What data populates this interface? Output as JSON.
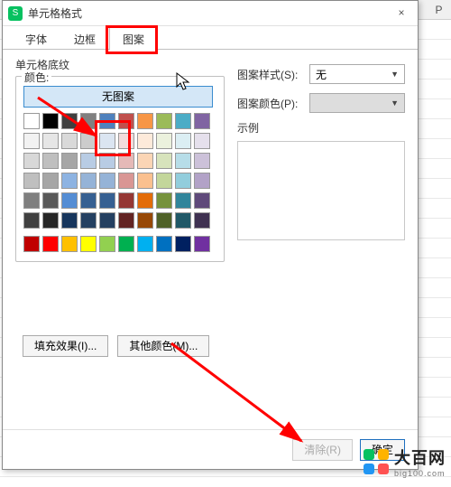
{
  "sheet": {
    "col_p": "P"
  },
  "dialog": {
    "title": "单元格格式",
    "close": "×",
    "tabs": {
      "font": "字体",
      "border": "边框",
      "pattern": "图案"
    },
    "section_title": "单元格底纹",
    "color_legend": "颜色:",
    "no_pattern": "无图案",
    "pattern_style_label": "图案样式(S):",
    "pattern_style_value": "无",
    "pattern_color_label": "图案颜色(P):",
    "preview_label": "示例",
    "fill_effects": "填充效果(I)...",
    "more_colors": "其他颜色(M)...",
    "clear": "清除(R)",
    "ok": "确定"
  },
  "palette": {
    "row1": [
      "#ffffff",
      "#000000",
      "#404040",
      "#808080",
      "#4f81bd",
      "#c0504d",
      "#f79646",
      "#9bbb59",
      "#4bacc6",
      "#8064a2"
    ],
    "row2": [
      "#f2f2f2",
      "#e6e6e6",
      "#d9d9d9",
      "#cccccc",
      "#dbe5f1",
      "#f2dcdb",
      "#fdeada",
      "#ebf1dd",
      "#dbeef3",
      "#e5e0ec"
    ],
    "row3": [
      "#d8d8d8",
      "#bfbfbf",
      "#a6a6a6",
      "#b8cce4",
      "#b8cce4",
      "#e5b9b7",
      "#fbd5b5",
      "#d7e3bc",
      "#b7dde8",
      "#ccc1d9"
    ],
    "row4": [
      "#bfbfbf",
      "#a6a6a6",
      "#8db3e2",
      "#95b3d7",
      "#95b3d7",
      "#d99694",
      "#fac08f",
      "#c3d69b",
      "#92cddc",
      "#b2a2c7"
    ],
    "row5": [
      "#7f7f7f",
      "#595959",
      "#548dd4",
      "#366092",
      "#366092",
      "#953734",
      "#e36c09",
      "#76923c",
      "#31859b",
      "#5f497a"
    ],
    "row6": [
      "#404040",
      "#262626",
      "#17365d",
      "#244061",
      "#244061",
      "#632423",
      "#974806",
      "#4f6128",
      "#205867",
      "#3f3151"
    ],
    "std": [
      "#c00000",
      "#ff0000",
      "#ffc000",
      "#ffff00",
      "#92d050",
      "#00b050",
      "#00b0f0",
      "#0070c0",
      "#002060",
      "#7030a0"
    ]
  },
  "watermark": {
    "main": "大百网",
    "sub": "big100.com"
  }
}
